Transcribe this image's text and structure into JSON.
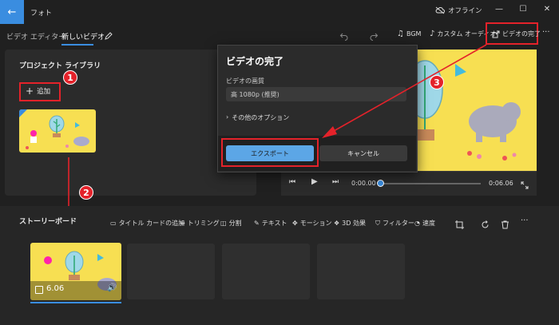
{
  "titlebar": {
    "back_glyph": "←",
    "app_title": "フォト",
    "offline_label": "オフライン",
    "minimize": "—",
    "maximize": "☐",
    "close": "✕"
  },
  "nav": {
    "crumb_parent": "ビデオ エディター",
    "crumb_sep": "›",
    "crumb_current": "新しいビデオ"
  },
  "toolbar": {
    "bgm": "BGM",
    "custom_audio": "カスタム オーディオ",
    "finish_video": "ビデオの完了",
    "more": "···"
  },
  "library": {
    "title": "プロジェクト ライブラリ",
    "add_label": "追加",
    "add_glyph": "+"
  },
  "dialog": {
    "title": "ビデオの完了",
    "quality_label": "ビデオの画質",
    "quality_value": "高 1080p (推奨)",
    "more_options": "その他のオプション",
    "export_label": "エクスポート",
    "cancel_label": "キャンセル"
  },
  "player": {
    "time_current": "0:00.00",
    "time_total": "0:06.06",
    "progress": 0
  },
  "storyboard": {
    "title": "ストーリーボード",
    "tools": {
      "title_card": "タイトル カードの追加",
      "trim": "トリミング",
      "split": "分割",
      "text": "テキスト",
      "motion": "モーション",
      "effects_3d": "3D 効果",
      "filters": "フィルター",
      "speed": "速度"
    },
    "clip_duration": "6.06"
  },
  "annotations": {
    "badge1": "1",
    "badge2": "2",
    "badge3": "3"
  },
  "colors": {
    "accent": "#3a8de0",
    "annotation_red": "#e4222a",
    "thumb_yellow": "#f7df52"
  }
}
